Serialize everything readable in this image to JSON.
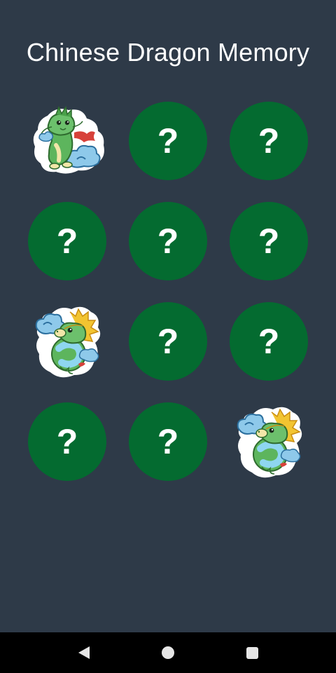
{
  "app": {
    "title": "Chinese Dragon Memory"
  },
  "board": {
    "hidden_symbol": "?",
    "cards": [
      {
        "state": "revealed",
        "image": "green-dragon-cloud-icon"
      },
      {
        "state": "hidden"
      },
      {
        "state": "hidden"
      },
      {
        "state": "hidden"
      },
      {
        "state": "hidden"
      },
      {
        "state": "hidden"
      },
      {
        "state": "revealed",
        "image": "coiled-dragon-cloud-icon"
      },
      {
        "state": "hidden"
      },
      {
        "state": "hidden"
      },
      {
        "state": "hidden"
      },
      {
        "state": "hidden"
      },
      {
        "state": "revealed",
        "image": "coiled-dragon-cloud-icon"
      }
    ]
  },
  "colors": {
    "background": "#2e3a48",
    "card_back": "#046b30",
    "text": "#ffffff",
    "navbar": "#000000"
  },
  "navbar": {
    "icons": [
      "back-icon",
      "home-icon",
      "recents-icon"
    ]
  }
}
